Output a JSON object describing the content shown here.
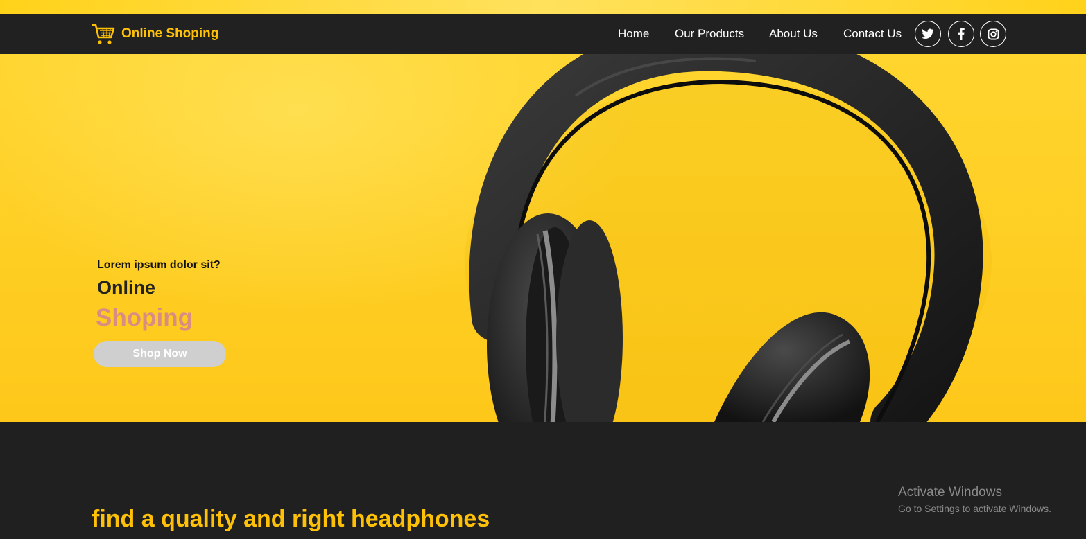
{
  "brand": {
    "name": "Online Shoping",
    "icon": "shopping-cart-icon",
    "color": "#ffc107"
  },
  "nav": {
    "links": [
      "Home",
      "Our Products",
      "About Us",
      "Contact Us"
    ],
    "social": [
      "twitter-icon",
      "facebook-icon",
      "instagram-icon"
    ]
  },
  "hero": {
    "question": "Lorem ipsum dolor sit?",
    "line1": "Online",
    "line2": "Shoping",
    "button": "Shop Now",
    "accent": "#d98d82",
    "background": "#fec81a"
  },
  "section": {
    "title": "find a quality and right headphones"
  },
  "watermark": {
    "title": "Activate Windows",
    "subtitle": "Go to Settings to activate Windows."
  }
}
